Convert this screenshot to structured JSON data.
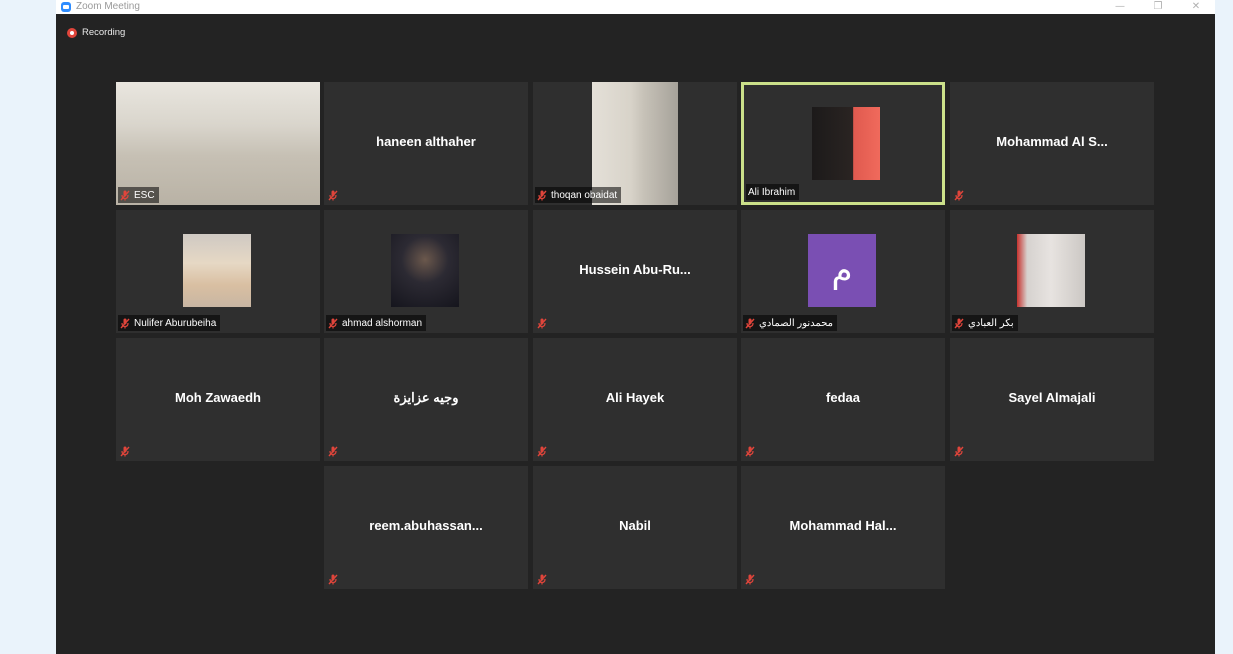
{
  "window": {
    "title": "Zoom Meeting",
    "controls": [
      "minimize",
      "restore",
      "close"
    ],
    "background": "#232323"
  },
  "recording": {
    "label": "Recording",
    "color": "#e0453b"
  },
  "participants": [
    {
      "name": "ESC",
      "display": "video",
      "muted": true
    },
    {
      "name": "haneen althaher",
      "display": "name",
      "muted": true
    },
    {
      "name": "thoqan obaidat",
      "display": "video",
      "muted": true
    },
    {
      "name": "Ali Ibrahim",
      "display": "photo",
      "muted": false,
      "active_speaker": true
    },
    {
      "name": "Mohammad  Al S...",
      "display": "name",
      "muted": true
    },
    {
      "name": "Nulifer Aburubeiha",
      "display": "photo",
      "muted": true
    },
    {
      "name": "ahmad alshorman",
      "display": "photo",
      "muted": true
    },
    {
      "name": "Hussein   Abu-Ru...",
      "display": "name",
      "muted": true
    },
    {
      "name": "محمدنور الصمادي",
      "display": "avatar",
      "avatar_letter": "م",
      "avatar_color": "#7a4fb3",
      "muted": true
    },
    {
      "name": "بكر العبادي",
      "display": "photo",
      "muted": true
    },
    {
      "name": "Moh Zawaedh",
      "display": "name",
      "muted": true
    },
    {
      "name": "وجيه عزايزة",
      "display": "name",
      "muted": true
    },
    {
      "name": "Ali Hayek",
      "display": "name",
      "muted": true
    },
    {
      "name": "fedaa",
      "display": "name",
      "muted": true
    },
    {
      "name": "Sayel Almajali",
      "display": "name",
      "muted": true
    },
    {
      "name": "reem.abuhassan...",
      "display": "name",
      "muted": true
    },
    {
      "name": "Nabil",
      "display": "name",
      "muted": true
    },
    {
      "name": "Mohammad  Hal...",
      "display": "name",
      "muted": true
    }
  ],
  "colors": {
    "tile": "#2f2f2f",
    "active_border": "#cbe08a",
    "muted_icon": "#e0453b"
  },
  "icons": {
    "muted": "microphone-muted-icon"
  }
}
